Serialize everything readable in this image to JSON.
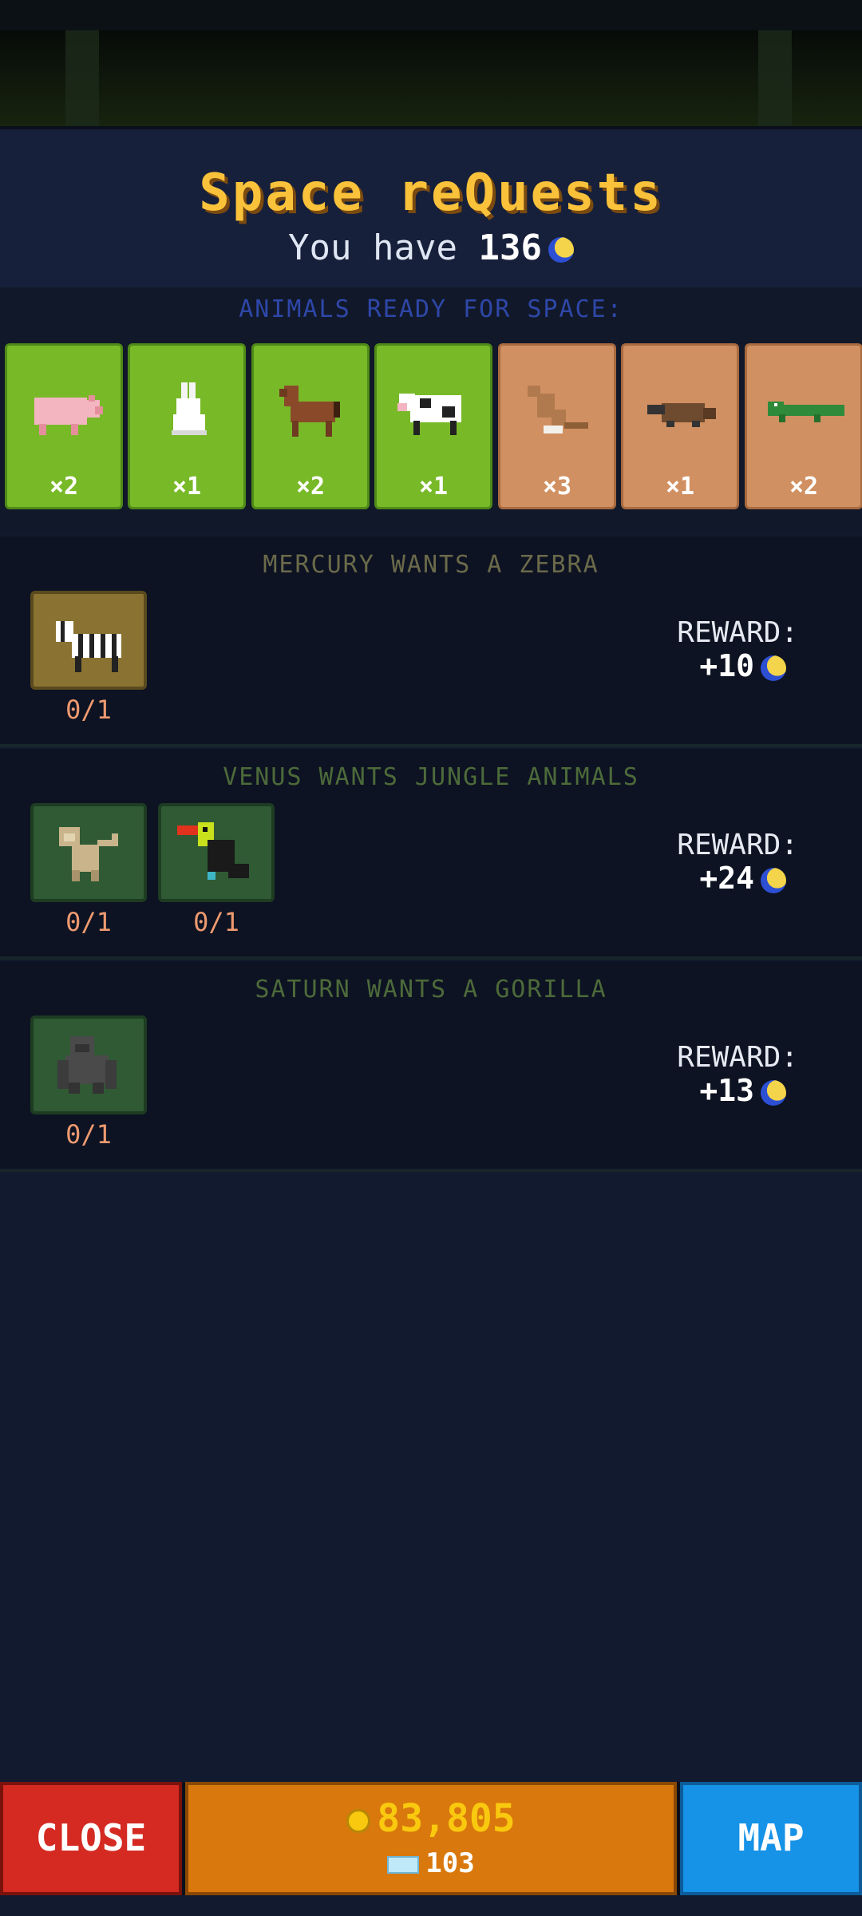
{
  "header": {
    "title": "Space reQuests",
    "balance_prefix": "You have",
    "balance_value": "136",
    "balance_icon": "moon-token-icon"
  },
  "ready": {
    "title": "ANIMALS READY FOR SPACE:",
    "cards": [
      {
        "animal": "pig-icon",
        "count": "×2",
        "bg": "green"
      },
      {
        "animal": "rabbit-icon",
        "count": "×1",
        "bg": "green"
      },
      {
        "animal": "horse-icon",
        "count": "×2",
        "bg": "green"
      },
      {
        "animal": "cow-icon",
        "count": "×1",
        "bg": "green"
      },
      {
        "animal": "kangaroo-icon",
        "count": "×3",
        "bg": "sand"
      },
      {
        "animal": "platypus-icon",
        "count": "×1",
        "bg": "sand"
      },
      {
        "animal": "crocodile-icon",
        "count": "×2",
        "bg": "sand"
      }
    ]
  },
  "quests": [
    {
      "title": "MERCURY WANTS A ZEBRA",
      "title_color": "#6b6a4a",
      "animals": [
        {
          "icon": "zebra-icon",
          "progress": "0/1"
        }
      ],
      "reward_label": "REWARD:",
      "reward_value": "+10"
    },
    {
      "title": "VENUS WANTS JUNGLE ANIMALS",
      "title_color": "#4d6a3a",
      "animals": [
        {
          "icon": "monkey-icon",
          "progress": "0/1"
        },
        {
          "icon": "toucan-icon",
          "progress": "0/1"
        }
      ],
      "reward_label": "REWARD:",
      "reward_value": "+24"
    },
    {
      "title": "SATURN WANTS A GORILLA",
      "title_color": "#4d6a3a",
      "animals": [
        {
          "icon": "gorilla-icon",
          "progress": "0/1"
        }
      ],
      "reward_label": "REWARD:",
      "reward_value": "+13"
    }
  ],
  "bottom": {
    "close_label": "CLOSE",
    "coins": "83,805",
    "gems": "103",
    "map_label": "MAP"
  },
  "colors": {
    "title": "#f9c23a",
    "card_green": "#78b928",
    "card_sand": "#d19062",
    "close": "#d42a22",
    "map": "#1692e6",
    "currency": "#d9780c"
  }
}
